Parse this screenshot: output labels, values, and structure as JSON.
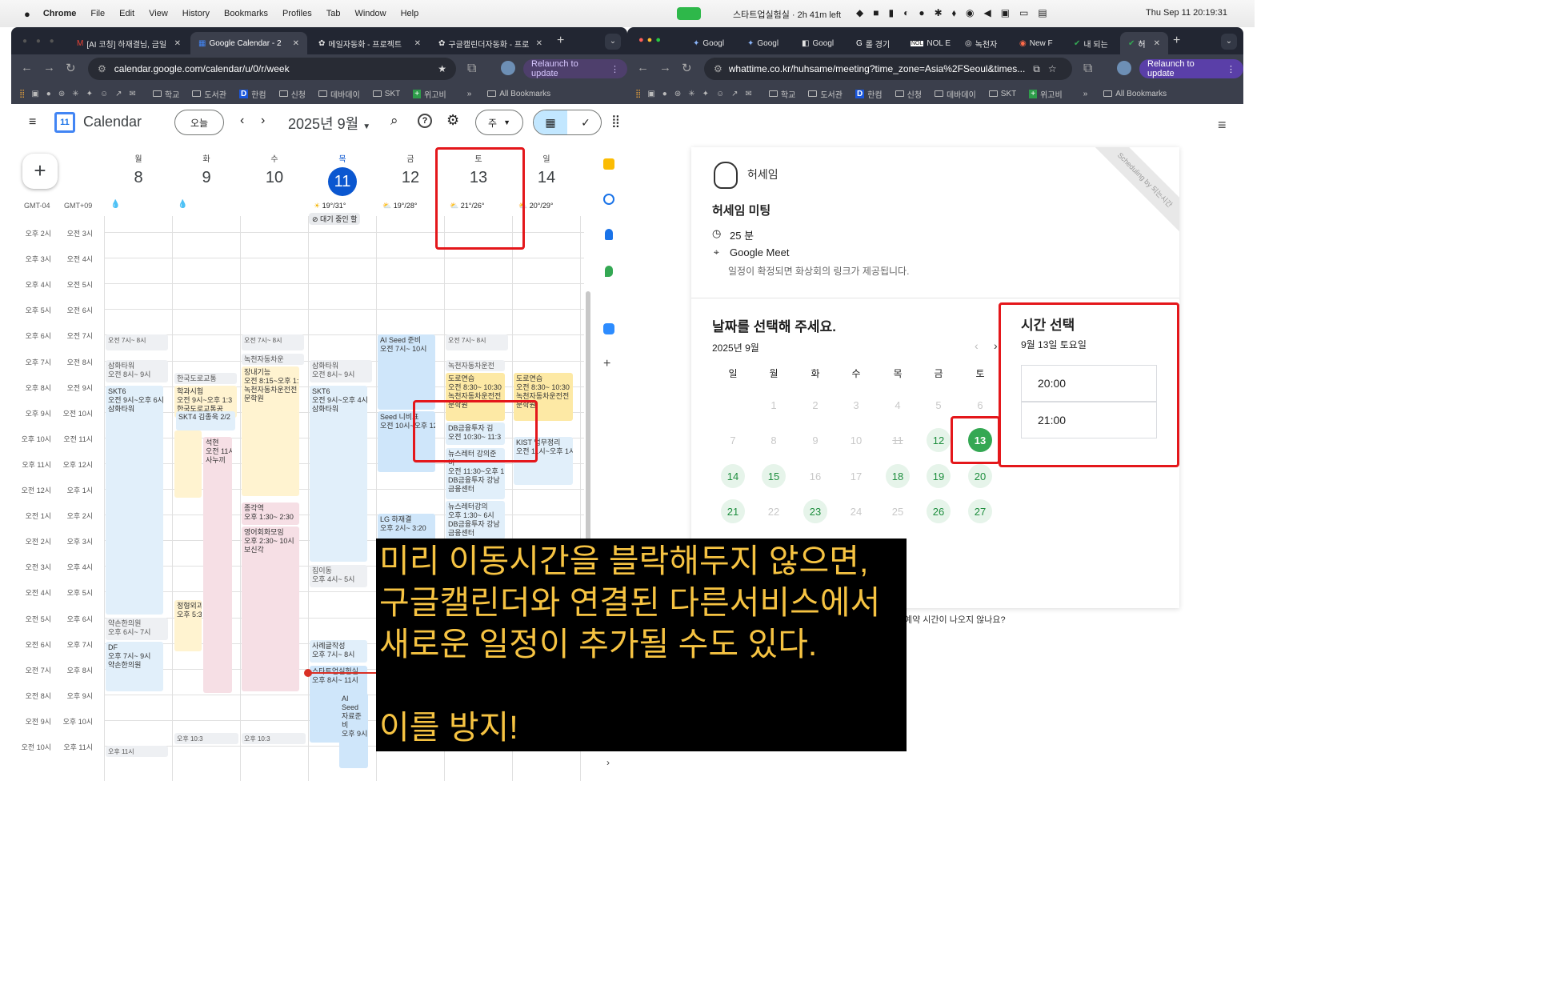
{
  "mac_menubar": {
    "app": "Chrome",
    "items": [
      "File",
      "Edit",
      "View",
      "History",
      "Bookmarks",
      "Profiles",
      "Tab",
      "Window",
      "Help"
    ],
    "timer": "스타트업실험실 · 2h 41m left",
    "clock": "Thu Sep 11  20:19:31"
  },
  "left_browser": {
    "tabs": [
      "[AI 코칭] 하재결님, 금일",
      "Google Calendar - 2",
      "메일자동화 - 프로젝트",
      "구글캘린더자동화 - 프로"
    ],
    "url": "calendar.google.com/calendar/u/0/r/week",
    "relaunch": "Relaunch to update",
    "bookmarks": [
      "학교",
      "도서관",
      "한컴",
      "신청",
      "데바데이",
      "SKT",
      "위고비"
    ],
    "all_bookmarks": "All Bookmarks"
  },
  "right_browser": {
    "tabs": [
      "Googl",
      "Googl",
      "Googl",
      "롤 경기",
      "NOL E",
      "녹천자",
      "New F",
      "내 되는",
      "허"
    ],
    "url": "whattime.co.kr/huhsame/meeting?time_zone=Asia%2FSeoul&times...",
    "relaunch": "Relaunch to update",
    "bookmarks": [
      "학교",
      "도서관",
      "한컴",
      "신청",
      "데바데이",
      "SKT",
      "위고비"
    ],
    "all_bookmarks": "All Bookmarks"
  },
  "calendar": {
    "app_title": "Calendar",
    "today_btn": "오늘",
    "month_label": "2025년 9월",
    "view_btn": "주",
    "tz1": "GMT-04",
    "tz2": "GMT+09",
    "days": [
      {
        "dow": "월",
        "num": "8",
        "weather": ""
      },
      {
        "dow": "화",
        "num": "9",
        "weather": ""
      },
      {
        "dow": "수",
        "num": "10",
        "weather": ""
      },
      {
        "dow": "목",
        "num": "11",
        "weather": "19°/31°"
      },
      {
        "dow": "금",
        "num": "12",
        "weather": "19°/28°"
      },
      {
        "dow": "토",
        "num": "13",
        "weather": "21°/26°"
      },
      {
        "dow": "일",
        "num": "14",
        "weather": "20°/29°"
      }
    ],
    "pending": "대기 중인 할",
    "hours_a": [
      "오후 2시",
      "오후 3시",
      "오후 4시",
      "오후 5시",
      "오후 6시",
      "오후 7시",
      "오후 8시",
      "오후 9시",
      "오후 10시",
      "오후 11시",
      "오전 12시",
      "오전 1시",
      "오전 2시",
      "오전 3시",
      "오전 4시",
      "오전 5시",
      "오전 6시",
      "오전 7시",
      "오전 8시",
      "오전 9시",
      "오전 10시"
    ],
    "hours_b": [
      "오전 3시",
      "오전 4시",
      "오전 5시",
      "오전 6시",
      "오전 7시",
      "오전 8시",
      "오전 9시",
      "오전 10시",
      "오전 11시",
      "오후 12시",
      "오후 1시",
      "오후 2시",
      "오후 3시",
      "오후 4시",
      "오후 5시",
      "오후 6시",
      "오후 7시",
      "오후 8시",
      "오후 9시",
      "오후 10시",
      "오후 11시"
    ],
    "events": {
      "mon_sleep": "오전 7시~ 8시",
      "mon_a": "삼화타워\n오전 8시~ 9시",
      "mon_b": "SKT6\n오전 9시~오후 6시\n삼화타워",
      "mon_c": "약손한의원\n오후 6시~ 7시",
      "mon_d": "DF\n오후 7시~ 9시\n약손한의원",
      "mon_night": "오후 11시",
      "tue_a": "한국도로교통",
      "tue_b": "학과시험\n오전 9시~오후 1:3\n한국도로교통공",
      "tue_c": "SKT4 김종욱 2/2",
      "tue_d": "석현\n오전 11시\n사누끼",
      "tue_e": "정형외과\n오후 5:3",
      "tue_night": "오후 10:3",
      "wed_sleep": "오전 7시~ 8시",
      "wed_a": "녹천자동차운",
      "wed_b": "장내기능\n오전 8:15~오후 1:\n녹천자동차운전전\n문학원",
      "wed_c": "종각역\n오후 1:30~ 2:30",
      "wed_d": "영어회화모임\n오후 2:30~ 10시\n보신각",
      "wed_night": "오후 10:3",
      "thu_a": "삼화타워\n오전 8시~ 9시",
      "thu_b": "SKT6\n오전 9시~오후 4시\n삼화타워",
      "thu_c": "집이동\n오후 4시~ 5시",
      "thu_d": "사례글작성\n오후 7시~ 8시",
      "thu_e": "스타트업실험실\n오후 8시~ 11시",
      "thu_f": "AI\nSeed\n자료준\n비\n오후 9시",
      "fri_a": "AI Seed 준비\n오전 7시~ 10시",
      "fri_b": "Seed 니비표\n오전 10시~오후 12",
      "fri_c": "LG 하재결\n오후 2시~ 3:20",
      "sat_sleep": "오전 7시~ 8시",
      "sat_a": "녹천자동차운전",
      "sat_b": "도로연습\n오전 8:30~ 10:30\n녹천자동차운전전\n문학원",
      "sat_c": "DB금융투자 김\n오전 10:30~ 11:3",
      "sat_d": "뉴스레터 강의준\n비\n오전 11:30~오후 1\nDB금융투자 강남\n금융센터",
      "sat_e": "뉴스레터강의\n오후 1:30~ 6시\nDB금융투자 강남\n금융센터",
      "sun_a": "도로연습\n오전 8:30~ 10:30\n녹천자동차운전전\n문학원",
      "sun_b": "KIST 업무정리\n오전 11시~오후 1시"
    }
  },
  "booking": {
    "host": "허세임",
    "meeting": "허세임 미팅",
    "duration": "25 분",
    "location": "Google Meet",
    "note": "일정이 확정되면 화상회의 링크가 제공됩니다.",
    "pick_date": "날짜를 선택해 주세요.",
    "month": "2025년 9월",
    "weekdays": [
      "일",
      "월",
      "화",
      "수",
      "목",
      "금",
      "토"
    ],
    "weeks": [
      [
        "",
        "1",
        "2",
        "3",
        "4",
        "5",
        "6"
      ],
      [
        "7",
        "8",
        "9",
        "10",
        "11",
        "12",
        "13"
      ],
      [
        "14",
        "15",
        "16",
        "17",
        "18",
        "19",
        "20"
      ],
      [
        "21",
        "22",
        "23",
        "24",
        "25",
        "26",
        "27"
      ]
    ],
    "pick_time": "시간 선택",
    "selected_date": "9월 13일 토요일",
    "slots": [
      "20:00",
      "21:00"
    ],
    "help": "예약 시간이 나오지 않나요?",
    "ribbon": "Scheduling by 되는시간"
  },
  "caption": "미리 이동시간을 블락해두지 않으면,\n구글캘린더와 연결된 다른서비스에서\n새로운 일정이 추가될 수도 있다.\n\n이를 방지!",
  "colors": {
    "accent": "#0b57d0",
    "highlight": "#e4171b",
    "green": "#34a853",
    "caption_text": "#f6c342"
  }
}
